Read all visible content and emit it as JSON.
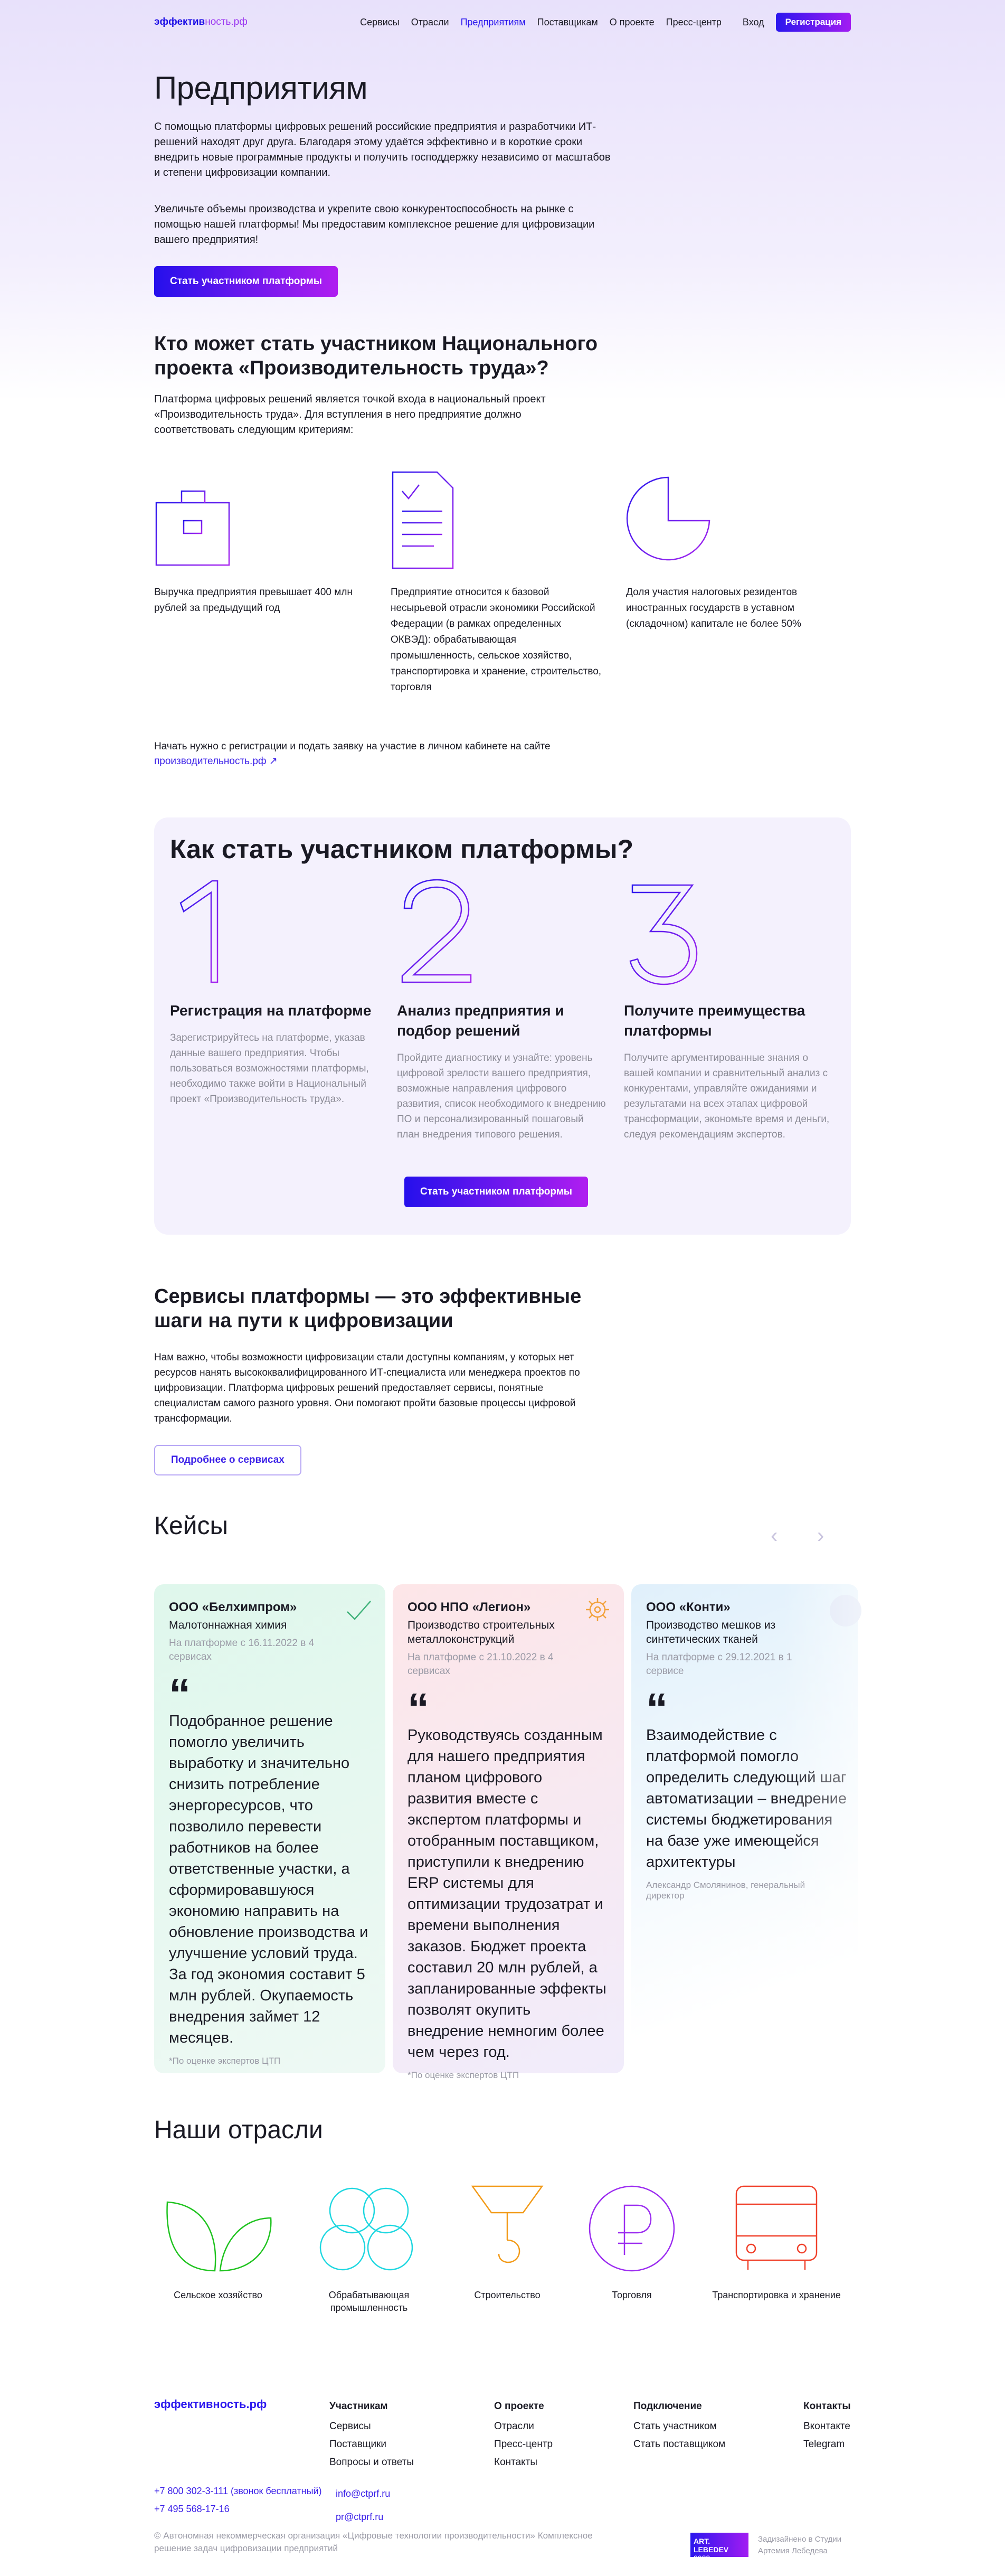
{
  "header": {
    "logo_part1": "эффектив",
    "logo_part2": "ность.рф",
    "nav": [
      "Сервисы",
      "Отрасли",
      "Предприятиям",
      "Поставщикам",
      "О проекте",
      "Пресс-центр"
    ],
    "login": "Вход",
    "register": "Регистрация"
  },
  "hero": {
    "title": "Предприятиям",
    "p1": "С помощью платформы цифровых решений российские предприятия и разработчики ИТ-решений находят друг друга. Благодаря этому удаётся эффективно и в короткие сроки внедрить новые программные продукты и получить господдержку независимо от масштабов и степени цифровизации компании.",
    "p2": "Увеличьте объемы производства и укрепите свою конкурентоспособность на рынке с помощью нашей платформы! Мы предоставим комплексное решение для цифровизации вашего предприятия!",
    "cta": "Стать участником платформы"
  },
  "who": {
    "title": "Кто может стать участником Национального проекта «Производительность труда»?",
    "text": "Платформа цифровых решений является точкой входа в национальный проект «Производительность труда». Для вступления в него предприятие должно соответствовать следующим критериям:",
    "criteria": [
      "Выручка предприятия превышает 400 млн рублей за предыдущий год",
      "Предприятие относится к базовой несырьевой отрасли экономики Российской Федерации (в рамках определенных ОКВЭД): обрабатывающая промышленность, сельское хозяйство, транспортировка и хранение, строительство, торговля",
      "Доля участия налоговых резидентов иностранных государств в уставном (складочном) капитале не более 50%"
    ],
    "note": "Начать нужно с регистрации и подать заявку на участие в личном кабинете на сайте",
    "link": "производительность.рф ↗"
  },
  "how": {
    "title": "Как стать участником платформы?",
    "steps": [
      {
        "title": "Регистрация на платформе",
        "text": "Зарегистрируйтесь на платформе, указав данные вашего предприятия. Чтобы пользоваться возможностями платформы, необходимо также войти в Национальный проект «Производительность труда»."
      },
      {
        "title": "Анализ предприятия и подбор решений",
        "text": "Пройдите диагностику и узнайте: уровень цифровой зрелости вашего предприятия, возможные направления цифрового развития, список необходимого к внедрению ПО и персонализированный пошаговый план внедрения типового решения."
      },
      {
        "title": "Получите преимущества платформы",
        "text": "Получите аргументированные знания о вашей компании и сравнительный анализ с конкурентами, управляйте ожиданиями и результатами на всех этапах цифровой трансформации, экономьте время и деньги, следуя рекомендациям экспертов."
      }
    ],
    "cta": "Стать участником платформы"
  },
  "services": {
    "title": "Сервисы платформы — это эффективные шаги на пути к цифровизации",
    "text": "Нам важно, чтобы возможности цифровизации стали доступны компаниям, у которых нет ресурсов нанять высококвалифицированного ИТ-специалиста или менеджера проектов по цифровизации. Платформа цифровых решений предоставляет сервисы, понятные специалистам самого разного уровня. Они помогают пройти базовые процессы цифровой трансформации.",
    "button": "Подробнее о сервисах"
  },
  "cases": {
    "title": "Кейсы",
    "items": [
      {
        "company": "ООО «Белхимпром»",
        "industry": "Малотоннажная химия",
        "since": "На платформе с 16.11.2022  в 4 сервисах",
        "quote": "Подобранное решение помогло увеличить выработку и значительно снизить потребление энергоресурсов, что позволило перевести работников на более ответственные участки, а сформировавшуюся экономию направить на обновление производства и улучшение условий труда. За год экономия составит 5 млн рублей. Окупаемость внедрения займет 12 месяцев.",
        "foot": "*По оценке экспертов ЦТП"
      },
      {
        "company": "ООО НПО «Легион»",
        "industry": "Производство строительных металлоконструкций",
        "since": "На платформе с 21.10.2022  в 4 сервисах",
        "quote": "Руководствуясь созданным для нашего предприятия планом цифрового развития вместе с экспертом платформы и отобранным поставщиком, приступили к внедрению ERP системы для оптимизации трудозатрат и времени выполнения заказов. Бюджет проекта составил 20 млн рублей, а запланированные эффекты позволят окупить внедрение немногим более чем через год.",
        "foot": "*По оценке экспертов ЦТП"
      },
      {
        "company": "ООО «Конти»",
        "industry": "Производство мешков из синтетических тканей",
        "since": "На платформе с 29.12.2021  в 1 сервисе",
        "quote": "Взаимодействие с платформой помогло определить следующий шаг автоматизации – внедрение системы бюджетирования на базе уже имеющейся архитектуры",
        "foot": "Александр Смолянинов, генеральный директор"
      }
    ]
  },
  "industries": {
    "title": "Наши отрасли",
    "items": [
      "Сельское хозяйство",
      "Обрабатывающая промышленность",
      "Строительство",
      "Торговля",
      "Транспортировка и хранение"
    ]
  },
  "footer": {
    "logo": "эффективность.рф",
    "cols": [
      {
        "title": "Участникам",
        "links": [
          "Сервисы",
          "Поставщики",
          "Вопросы и ответы"
        ]
      },
      {
        "title": "О проекте",
        "links": [
          "Отрасли",
          "Пресс-центр",
          "Контакты"
        ]
      },
      {
        "title": "Подключение",
        "links": [
          "Стать участником",
          "Стать поставщиком"
        ]
      },
      {
        "title": "Контакты",
        "links": [
          "Вконтакте",
          "Telegram"
        ]
      }
    ],
    "phone1": "+7 800 302-3-111 (звонок бесплатный)",
    "phone2": "+7 495 568-17-16",
    "email1": "info@ctprf.ru",
    "email2": "pr@ctprf.ru",
    "copyright": "© Автономная некоммерческая организация «Цифровые технологии производительности» Комплексное решение задач цифровизации предприятий",
    "studio_logo": "ART. LEBEDEV",
    "studio_year": "2022",
    "studio": "Задизайнено в Студии Артемия Лебедева"
  }
}
